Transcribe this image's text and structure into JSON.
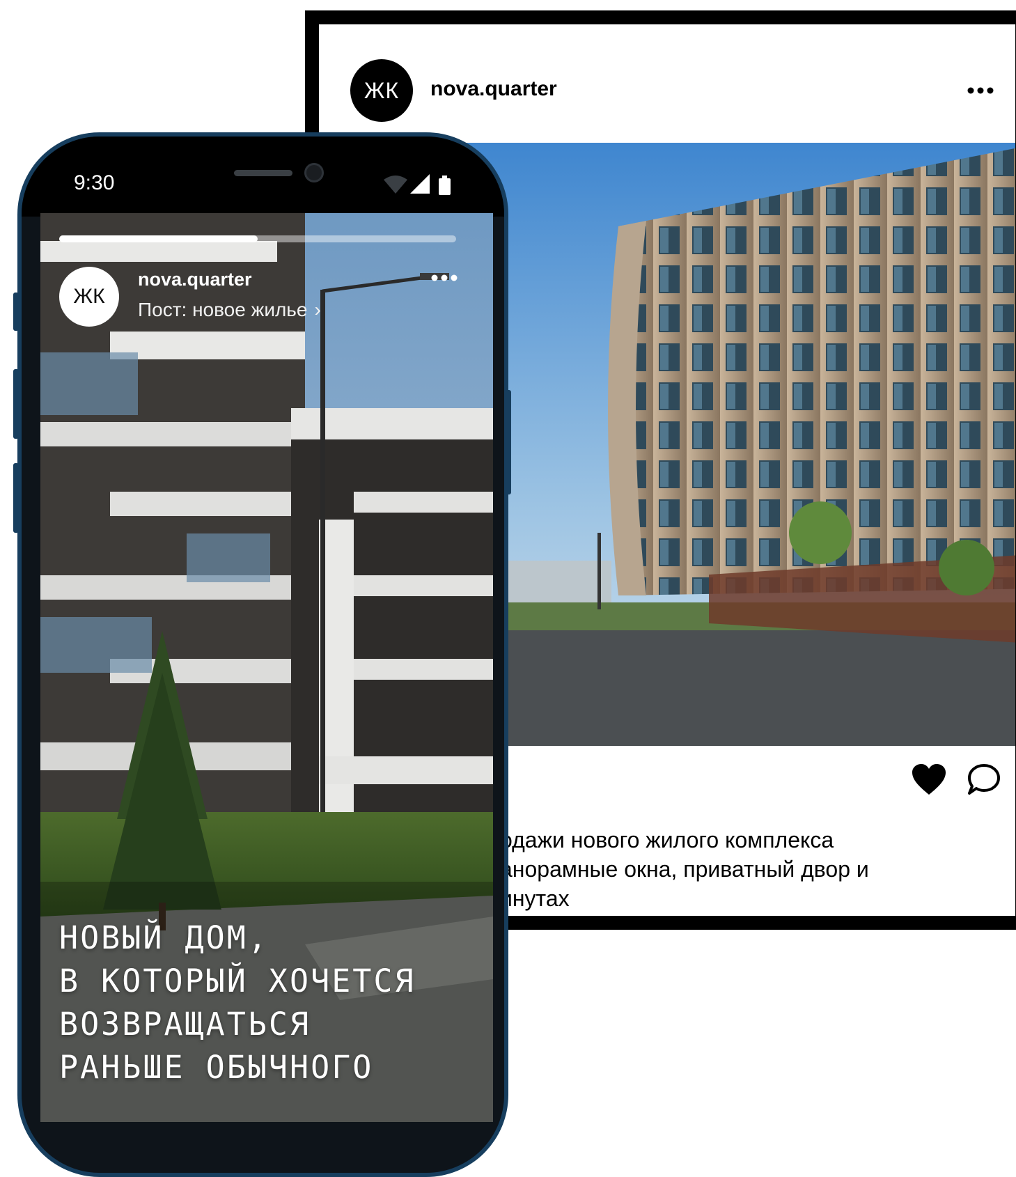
{
  "post": {
    "avatar_text": "ЖК",
    "username": "nova.quarter",
    "more_icon": "more-horizontal-icon",
    "photo_alt": "",
    "actions": {
      "like_icon": "heart-filled-icon",
      "comment_icon": "comment-bubble-icon"
    },
    "caption_lines": [
      "одажи нового жилого комплекса",
      "анорамные окна, приватный двор и",
      "инутах"
    ]
  },
  "phone": {
    "status": {
      "time": "9:30"
    },
    "story": {
      "progress": 0.5,
      "avatar_text": "ЖК",
      "username": "nova.quarter",
      "subtitle": "Пост: новое жилье",
      "chevron": "›",
      "headline_lines": [
        "НОВЫЙ ДОМ,",
        "В КОТОРЫЙ ХОЧЕТСЯ",
        "ВОЗВРАЩАТЬСЯ",
        "РАНЬШЕ ОБЫЧНОГО"
      ]
    }
  },
  "colors": {
    "phone_frame": "#173e5e",
    "post_border": "#000000",
    "accent_white": "#ffffff"
  }
}
